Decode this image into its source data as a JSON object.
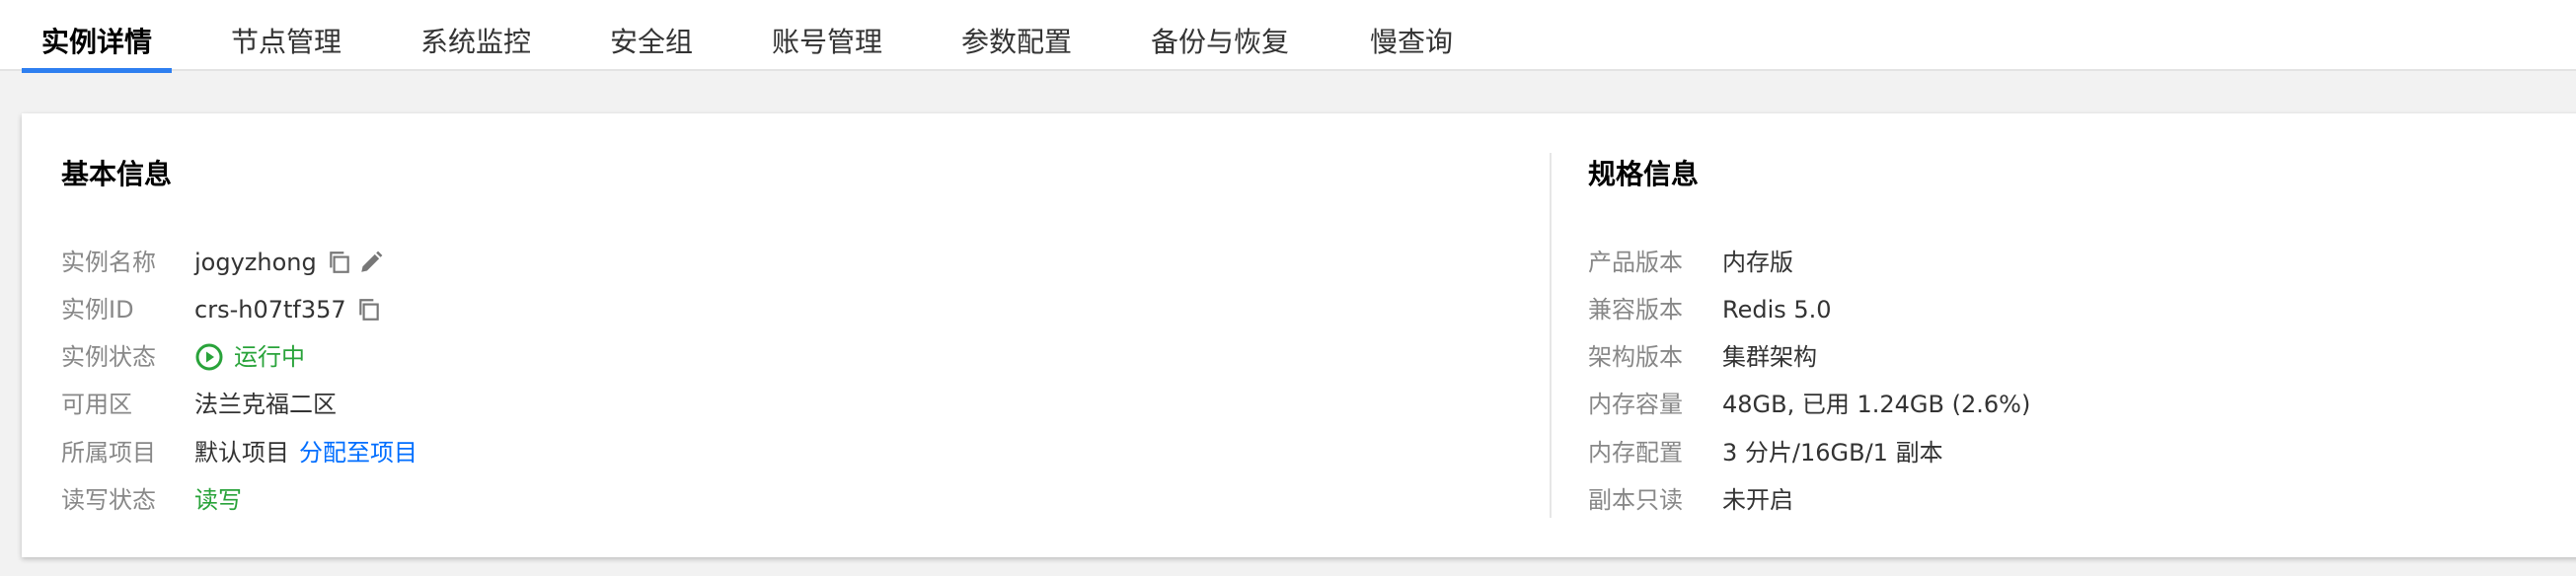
{
  "tabs": [
    {
      "label": "实例详情",
      "active": true
    },
    {
      "label": "节点管理"
    },
    {
      "label": "系统监控"
    },
    {
      "label": "安全组"
    },
    {
      "label": "账号管理"
    },
    {
      "label": "参数配置"
    },
    {
      "label": "备份与恢复"
    },
    {
      "label": "慢查询"
    }
  ],
  "basic": {
    "title": "基本信息",
    "name_label": "实例名称",
    "name_value": "jogyzhong",
    "id_label": "实例ID",
    "id_value": "crs-h07tf357",
    "status_label": "实例状态",
    "status_value": "运行中",
    "zone_label": "可用区",
    "zone_value": "法兰克福二区",
    "project_label": "所属项目",
    "project_value": "默认项目",
    "project_link": "分配至项目",
    "rw_label": "读写状态",
    "rw_value": "读写"
  },
  "spec": {
    "title": "规格信息",
    "rows": [
      {
        "label": "产品版本",
        "value": "内存版"
      },
      {
        "label": "兼容版本",
        "value": "Redis 5.0"
      },
      {
        "label": "架构版本",
        "value": "集群架构"
      },
      {
        "label": "内存容量",
        "value": "48GB, 已用 1.24GB (2.6%)"
      },
      {
        "label": "内存配置",
        "value": "3 分片/16GB/1 副本"
      },
      {
        "label": "副本只读",
        "value": "未开启"
      }
    ]
  },
  "icons": {
    "copy": "copy-icon",
    "edit": "pencil-icon",
    "status": "play-circle-icon"
  },
  "colors": {
    "accent": "#2e7ff0",
    "link": "#006eff",
    "success": "#29a33a",
    "label": "#888888"
  }
}
